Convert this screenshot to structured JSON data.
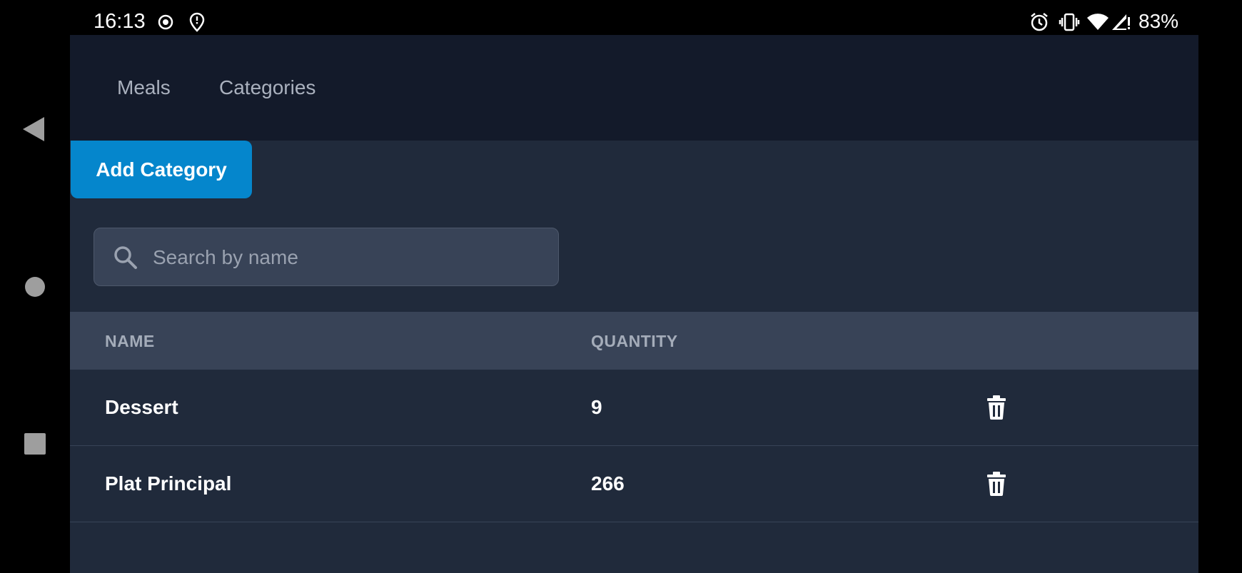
{
  "status_bar": {
    "time": "16:13",
    "battery": "83%",
    "icons": [
      "record-icon",
      "location-alert-icon",
      "alarm-icon",
      "vibrate-icon",
      "wifi-icon",
      "signal-icon"
    ]
  },
  "nav_bar": {
    "buttons": [
      "back-icon",
      "home-icon",
      "recents-icon"
    ]
  },
  "tabs": [
    {
      "label": "Meals"
    },
    {
      "label": "Categories"
    }
  ],
  "toolbar": {
    "add_label": "Add Category"
  },
  "search": {
    "placeholder": "Search by name",
    "value": ""
  },
  "table": {
    "columns": [
      "NAME",
      "QUANTITY"
    ],
    "rows": [
      {
        "name": "Dessert",
        "quantity": "9"
      },
      {
        "name": "Plat Principal",
        "quantity": "266"
      }
    ]
  },
  "colors": {
    "accent": "#0586cc",
    "header_bg": "#131a2a",
    "content_bg": "#202a3b",
    "table_header_bg": "#384357"
  }
}
